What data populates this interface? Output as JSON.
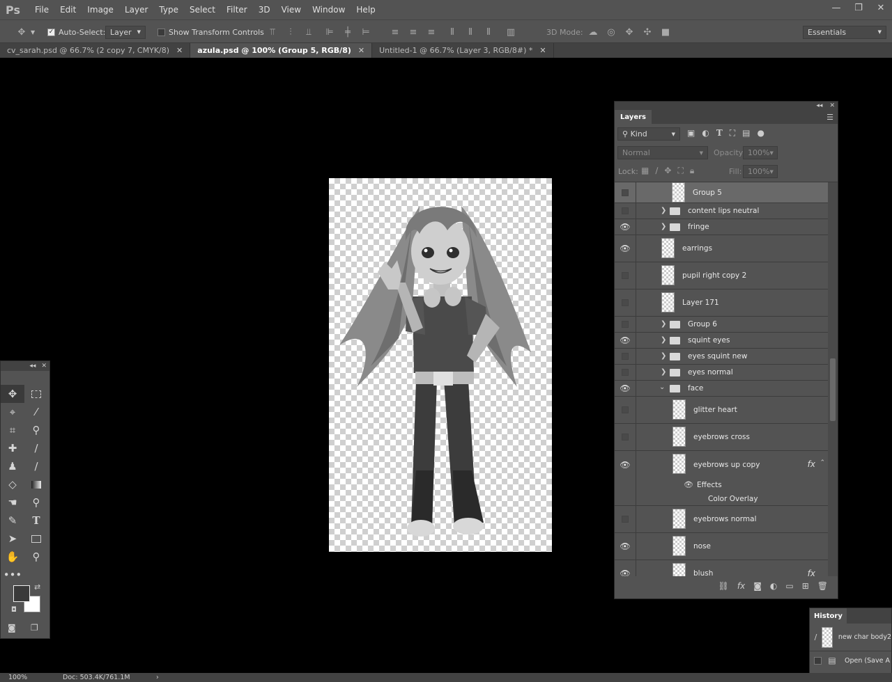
{
  "app": {
    "logo": "Ps"
  },
  "menu": [
    "File",
    "Edit",
    "Image",
    "Layer",
    "Type",
    "Select",
    "Filter",
    "3D",
    "View",
    "Window",
    "Help"
  ],
  "window_buttons": {
    "min": "—",
    "restore": "❐",
    "close": "✕"
  },
  "options": {
    "auto_select_label": "Auto-Select:",
    "auto_select_value": "Layer",
    "show_transform_label": "Show Transform Controls",
    "mode_3d_label": "3D Mode:",
    "workspace": "Essentials"
  },
  "doc_tabs": [
    {
      "label": "cv_sarah.psd @ 66.7% (2 copy 7, CMYK/8)",
      "close": "✕"
    },
    {
      "label": "azula.psd @ 100% (Group 5, RGB/8)",
      "close": "✕"
    },
    {
      "label": "Untitled-1 @ 66.7% (Layer 3, RGB/8#) *",
      "close": "✕"
    }
  ],
  "layers_panel": {
    "title": "Layers",
    "filter_kind": "Kind",
    "blend_mode": "Normal",
    "opacity_label": "Opacity:",
    "opacity_value": "100%",
    "lock_label": "Lock:",
    "fill_label": "Fill:",
    "fill_value": "100%",
    "layers": [
      {
        "name": "Group 5",
        "visible": false
      },
      {
        "name": "content lips neutral",
        "visible": false
      },
      {
        "name": "fringe",
        "visible": true
      },
      {
        "name": "earrings",
        "visible": true
      },
      {
        "name": "pupil right copy 2",
        "visible": false
      },
      {
        "name": "Layer 171",
        "visible": false
      },
      {
        "name": "Group 6",
        "visible": false
      },
      {
        "name": "squint eyes",
        "visible": true
      },
      {
        "name": "eyes squint new",
        "visible": false
      },
      {
        "name": "eyes normal",
        "visible": false
      },
      {
        "name": "face",
        "visible": true
      },
      {
        "name": "glitter heart",
        "visible": false
      },
      {
        "name": "eyebrows cross",
        "visible": false
      },
      {
        "name": "eyebrows up copy",
        "visible": true
      },
      {
        "name": "Effects"
      },
      {
        "name": "Color Overlay"
      },
      {
        "name": "eyebrows normal",
        "visible": false
      },
      {
        "name": "nose",
        "visible": true
      },
      {
        "name": "blush",
        "visible": true
      }
    ],
    "fx_label": "fx"
  },
  "history_panel": {
    "title": "History",
    "items": [
      "new char body2",
      "Open (Save A"
    ]
  },
  "status": {
    "zoom": "100%",
    "doc": "Doc: 503.4K/761.1M"
  }
}
